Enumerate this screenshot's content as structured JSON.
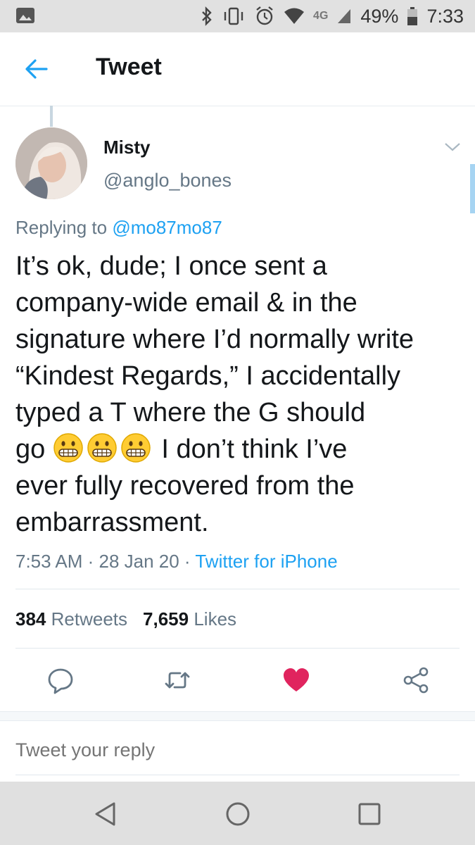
{
  "status_bar": {
    "network": "4G",
    "battery": "49%",
    "time": "7:33"
  },
  "header": {
    "title": "Tweet"
  },
  "tweet": {
    "author_name": "Misty",
    "author_handle": "@anglo_bones",
    "replying_prefix": "Replying to ",
    "replying_to": "@mo87mo87",
    "lines": [
      "It’s ok, dude; I once sent a",
      "company-wide email & in the",
      "signature where I’d normally write",
      "“Kindest Regards,” I accidentally",
      "typed a T where the G should",
      "go",
      "I don’t think I’ve",
      "ever fully recovered from the",
      "embarrassment."
    ],
    "timestamp": "7:53 AM · 28 Jan 20 · ",
    "source": "Twitter for iPhone",
    "retweets_count": "384",
    "retweets_label": "Retweets",
    "likes_count": "7,659",
    "likes_label": "Likes",
    "liked": true
  },
  "reply": {
    "placeholder": "Tweet your reply"
  },
  "colors": {
    "accent": "#1da1f2",
    "like": "#e0245e",
    "muted": "#657786"
  },
  "icons": [
    "back-arrow-icon",
    "caret-down-icon",
    "reply-icon",
    "retweet-icon",
    "heart-icon",
    "share-icon",
    "grimacing-emoji"
  ]
}
